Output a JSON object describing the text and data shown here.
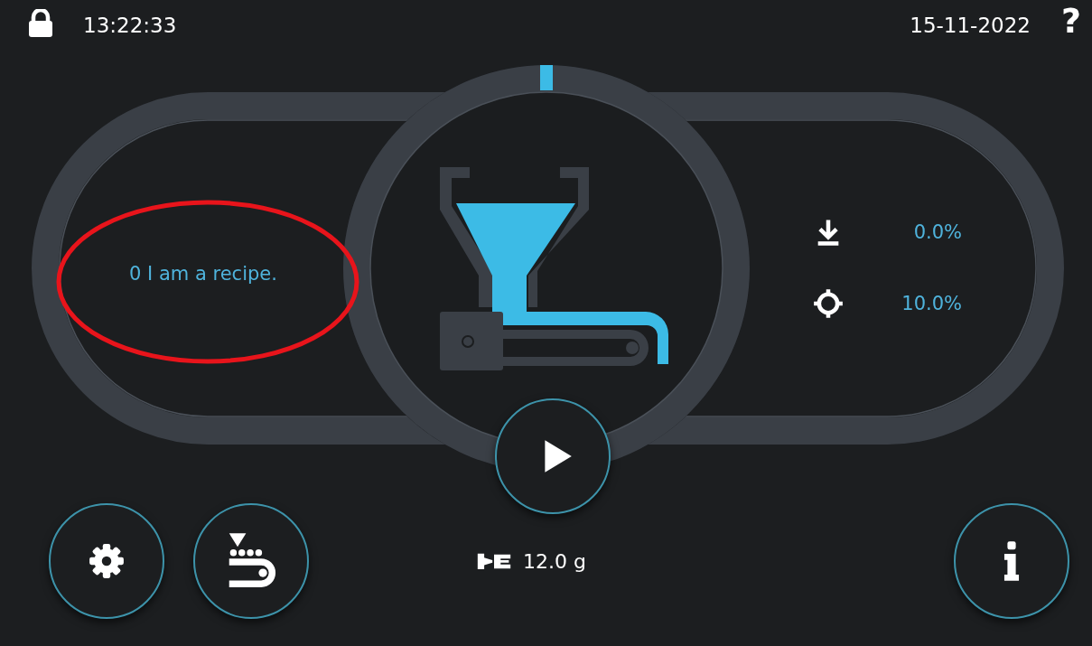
{
  "status_bar": {
    "locked": true,
    "time": "13:22:33",
    "date": "15-11-2022",
    "help": "?"
  },
  "recipe": {
    "name": "0 I am a recipe.",
    "circled": true
  },
  "stats": [
    {
      "kind": "discharge",
      "value": "0.0%"
    },
    {
      "kind": "target",
      "value": "10.0%"
    }
  ],
  "play": {
    "kind": "play"
  },
  "weight": {
    "value": "12.0 g"
  },
  "buttons": [
    {
      "kind": "settings"
    },
    {
      "kind": "conveyor"
    },
    {
      "kind": "info"
    }
  ]
}
